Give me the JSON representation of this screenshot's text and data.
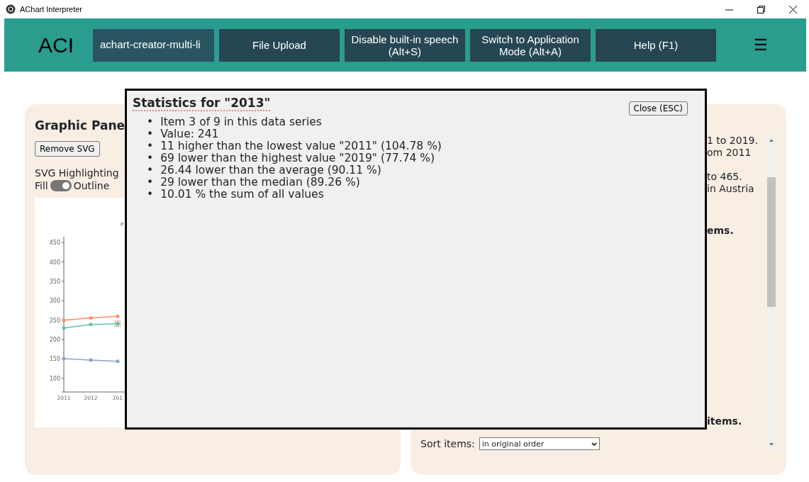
{
  "window": {
    "title": "AChart Interpreter"
  },
  "navbar": {
    "logo": "ACI",
    "chart_select": {
      "value": "achart-creator-multi-li"
    },
    "buttons": [
      "File Upload",
      "Disable built-in speech (Alt+S)",
      "Switch to Application Mode (Alt+A)",
      "Help (F1)"
    ],
    "menu_icon": "☰"
  },
  "graphic_panel": {
    "title": "Graphic Pane",
    "remove_button": "Remove SVG",
    "highlighting_label": "SVG Highlighting",
    "switch": {
      "left_label": "Fill",
      "right_label": "Outline",
      "on": true
    },
    "chart": {
      "point_selection": [
        [
          false,
          false,
          false
        ],
        [
          false,
          false,
          true
        ],
        [
          false,
          false,
          false
        ]
      ],
      "chart_data": {
        "type": "line",
        "title": "P",
        "categories": [
          "2011",
          "2012",
          "201"
        ],
        "series": [
          {
            "color": "#fc8d62",
            "values": [
              250,
              256,
              260
            ]
          },
          {
            "color": "#66c2a5",
            "values": [
              230,
              239,
              241
            ]
          },
          {
            "color": "#8da0cb",
            "values": [
              151,
              147,
              144
            ]
          }
        ],
        "ylim": [
          65,
          465
        ],
        "yticks": [
          100,
          150,
          200,
          250,
          300,
          350,
          400,
          450
        ]
      }
    }
  },
  "text_panel": {
    "fragments": [
      {
        "text": "1 to 2019.",
        "bold": false
      },
      {
        "text": "om 2011",
        "bold": false
      },
      {
        "text": "to 465.",
        "bold": false
      },
      {
        "text": "in Austria",
        "bold": false
      },
      {
        "text": "ems.",
        "bold": true
      },
      {
        "text": "items.",
        "bold": true
      }
    ],
    "sort": {
      "label": "Sort items:",
      "value": "in original order"
    }
  },
  "dialog": {
    "title": "Statistics for \"2013\"",
    "close_button": "Close (ESC)",
    "bullet": "•",
    "items": [
      "Item 3 of 9 in this data series",
      "Value: 241",
      "11 higher than the lowest value \"2011\" (104.78 %)",
      "69 lower than the highest value \"2019\" (77.74 %)",
      "26.44 lower than the average (90.11 %)",
      "29 lower than the median (89.26 %)",
      "10.01 % the sum of all values"
    ]
  }
}
